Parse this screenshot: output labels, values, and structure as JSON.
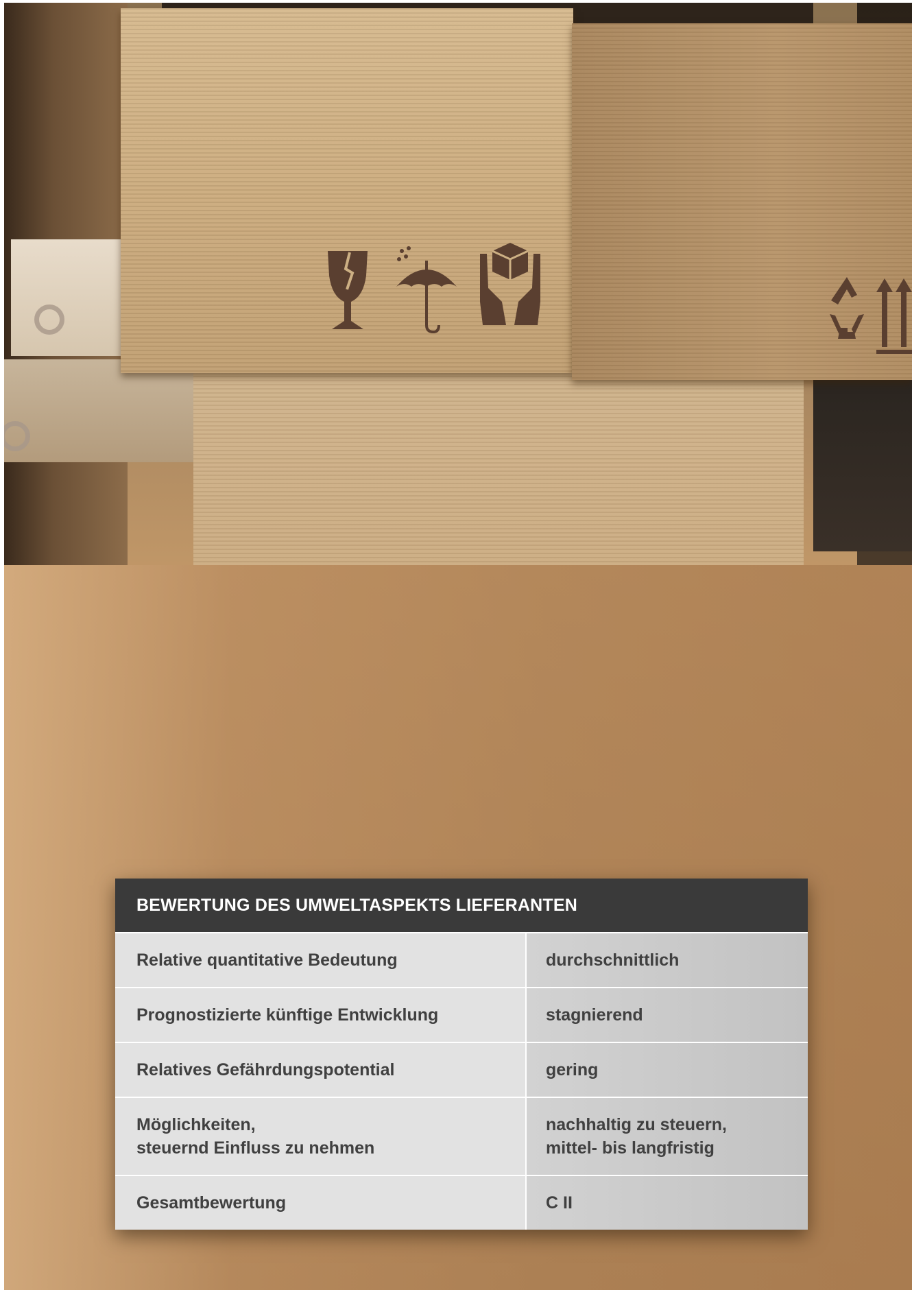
{
  "panel": {
    "title": "BEWERTUNG DES UMWELTASPEKTS LIEFERANTEN",
    "rows": [
      {
        "label": "Relative quantitative Bedeutung",
        "value": "durchschnittlich"
      },
      {
        "label": "Prognostizierte künftige Entwicklung",
        "value": "stagnierend"
      },
      {
        "label": "Relatives Gefährdungspotential",
        "value": "gering"
      },
      {
        "label": "Möglichkeiten,\nsteuernd Einfluss zu nehmen",
        "value": "nachhaltig zu steuern,\nmittel- bis langfristig"
      },
      {
        "label": "Gesamtbewertung",
        "value": "C II"
      }
    ]
  },
  "photo": {
    "box_symbols": [
      "fragile-glass-icon",
      "keep-dry-umbrella-icon",
      "handle-with-care-icon",
      "recycle-icon",
      "this-way-up-arrows-icon"
    ],
    "colors": {
      "cardboard": "#cdb084",
      "symbol": "#5a3f30",
      "header": "#3a3a3a",
      "label_bg": "#e2e2e2",
      "value_bg": "#c8c8c8",
      "text": "#404040"
    }
  }
}
